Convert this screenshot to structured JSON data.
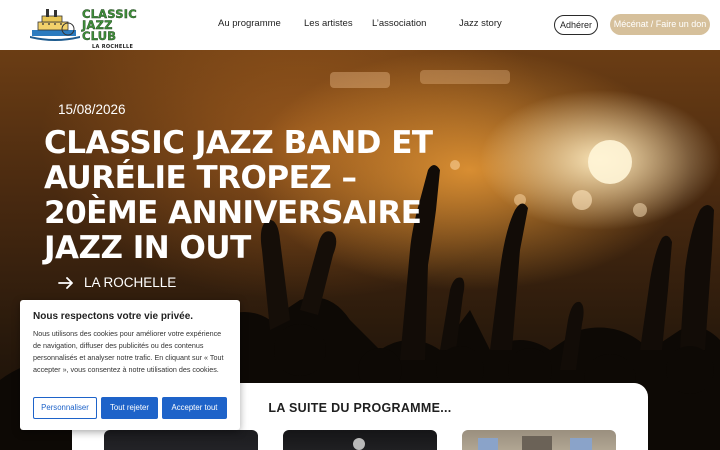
{
  "header": {
    "logo": {
      "line1": "CLASSIC",
      "line2": "JAZZ CLUB",
      "line3": "LA ROCHELLE"
    },
    "nav": [
      {
        "label": "Au programme"
      },
      {
        "label": "Les artistes"
      },
      {
        "label": "L’association"
      },
      {
        "label": "Jazz story"
      }
    ],
    "adherer_label": "Adhérer",
    "don_label": "Mécénat / Faire un don"
  },
  "hero": {
    "date": "15/08/2026",
    "title": "CLASSIC JAZZ BAND ET AURÉLIE TROPEZ – 20ÈME ANNIVERSAIRE JAZZ IN OUT",
    "location": "LA ROCHELLE",
    "location_icon": "arrow-right-icon"
  },
  "cookie": {
    "title": "Nous respectons votre vie privée.",
    "text": "Nous utilisons des cookies pour améliorer votre expérience de navigation, diffuser des publicités ou des contenus personnalisés et analyser notre trafic. En cliquant sur « Tout accepter », vous consentez à notre utilisation des cookies.",
    "btn_personnaliser": "Personnaliser",
    "btn_rejeter": "Tout rejeter",
    "btn_accepter": "Accepter tout"
  },
  "programme": {
    "title": "LA SUITE DU PROGRAMME..."
  },
  "colors": {
    "accent_gold": "#d6c09b",
    "cookie_blue": "#1e63c9",
    "logo_green": "#3f8f3a"
  }
}
